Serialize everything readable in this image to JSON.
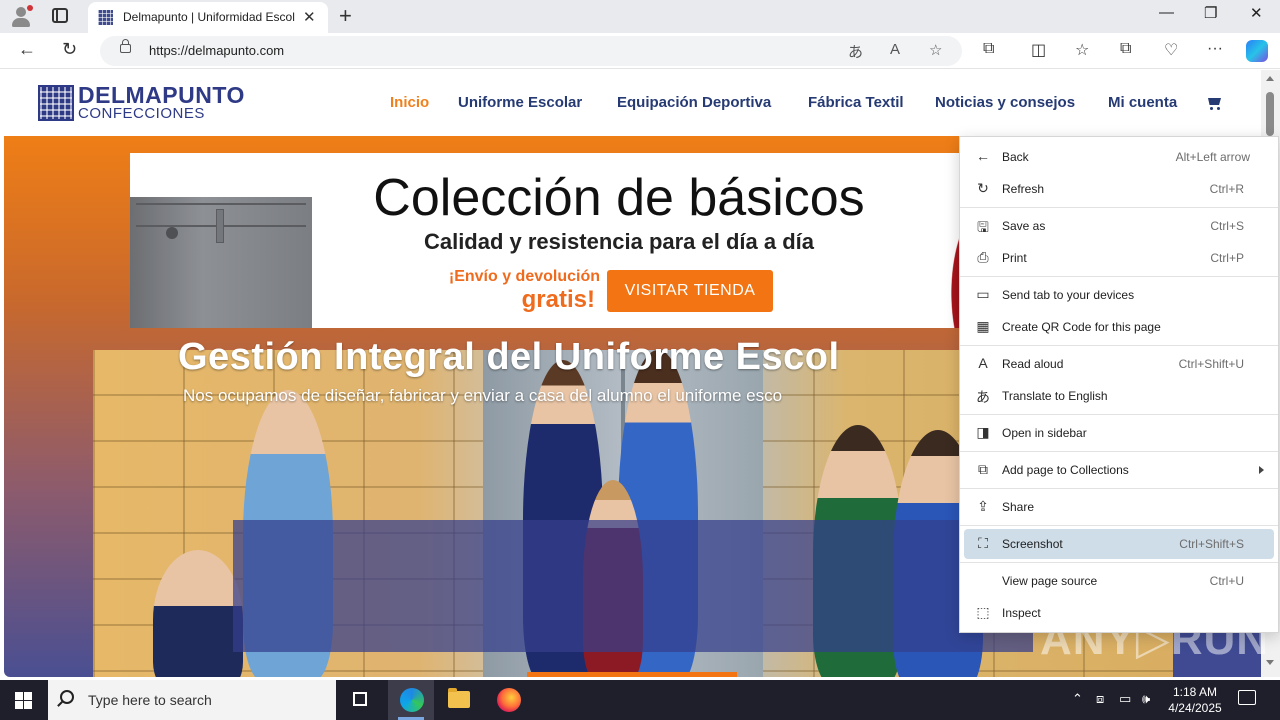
{
  "browser": {
    "tab_title": "Delmapunto | Uniformidad Escol",
    "url": "https://delmapunto.com"
  },
  "site": {
    "logo_title": "DELMAPUNTO",
    "logo_sub": "CONFECCIONES",
    "nav": [
      {
        "label": "Inicio",
        "active": true
      },
      {
        "label": "Uniforme Escolar"
      },
      {
        "label": "Equipación Deportiva"
      },
      {
        "label": "Fábrica Textil"
      },
      {
        "label": "Noticias y consejos"
      },
      {
        "label": "Mi cuenta"
      }
    ],
    "banner": {
      "title": "Colección de básicos",
      "subtitle": "Calidad y resistencia para el día a día",
      "promo_line1": "¡Envío y devolución",
      "promo_line2": "gratis!",
      "button": "VISITAR TIENDA"
    },
    "hero": {
      "title": "Gestión Integral del Uniforme Escol",
      "subtitle": "Nos ocupamos de diseñar, fabricar y enviar a casa del alumno el uniforme esco"
    },
    "watermark": "ANY▷RUN"
  },
  "context_menu": {
    "items": [
      {
        "label": "Back",
        "shortcut": "Alt+Left arrow",
        "icon": "back-arrow-icon"
      },
      {
        "label": "Refresh",
        "shortcut": "Ctrl+R",
        "icon": "refresh-icon"
      },
      {
        "label": "Save as",
        "shortcut": "Ctrl+S",
        "icon": "save-icon"
      },
      {
        "label": "Print",
        "shortcut": "Ctrl+P",
        "icon": "print-icon"
      },
      {
        "label": "Send tab to your devices",
        "shortcut": "",
        "icon": "devices-icon"
      },
      {
        "label": "Create QR Code for this page",
        "shortcut": "",
        "icon": "qr-code-icon"
      },
      {
        "label": "Read aloud",
        "shortcut": "Ctrl+Shift+U",
        "icon": "read-aloud-icon"
      },
      {
        "label": "Translate to English",
        "shortcut": "",
        "icon": "translate-icon"
      },
      {
        "label": "Open in sidebar",
        "shortcut": "",
        "icon": "sidebar-icon"
      },
      {
        "label": "Add page to Collections",
        "shortcut": "",
        "icon": "collections-icon",
        "submenu": true
      },
      {
        "label": "Share",
        "shortcut": "",
        "icon": "share-icon"
      },
      {
        "label": "Screenshot",
        "shortcut": "Ctrl+Shift+S",
        "icon": "screenshot-icon",
        "highlighted": true
      },
      {
        "label": "View page source",
        "shortcut": "Ctrl+U",
        "icon": ""
      },
      {
        "label": "Inspect",
        "shortcut": "",
        "icon": "inspect-icon"
      }
    ]
  },
  "taskbar": {
    "search_placeholder": "Type here to search",
    "time": "1:18 AM",
    "date": "4/24/2025"
  }
}
